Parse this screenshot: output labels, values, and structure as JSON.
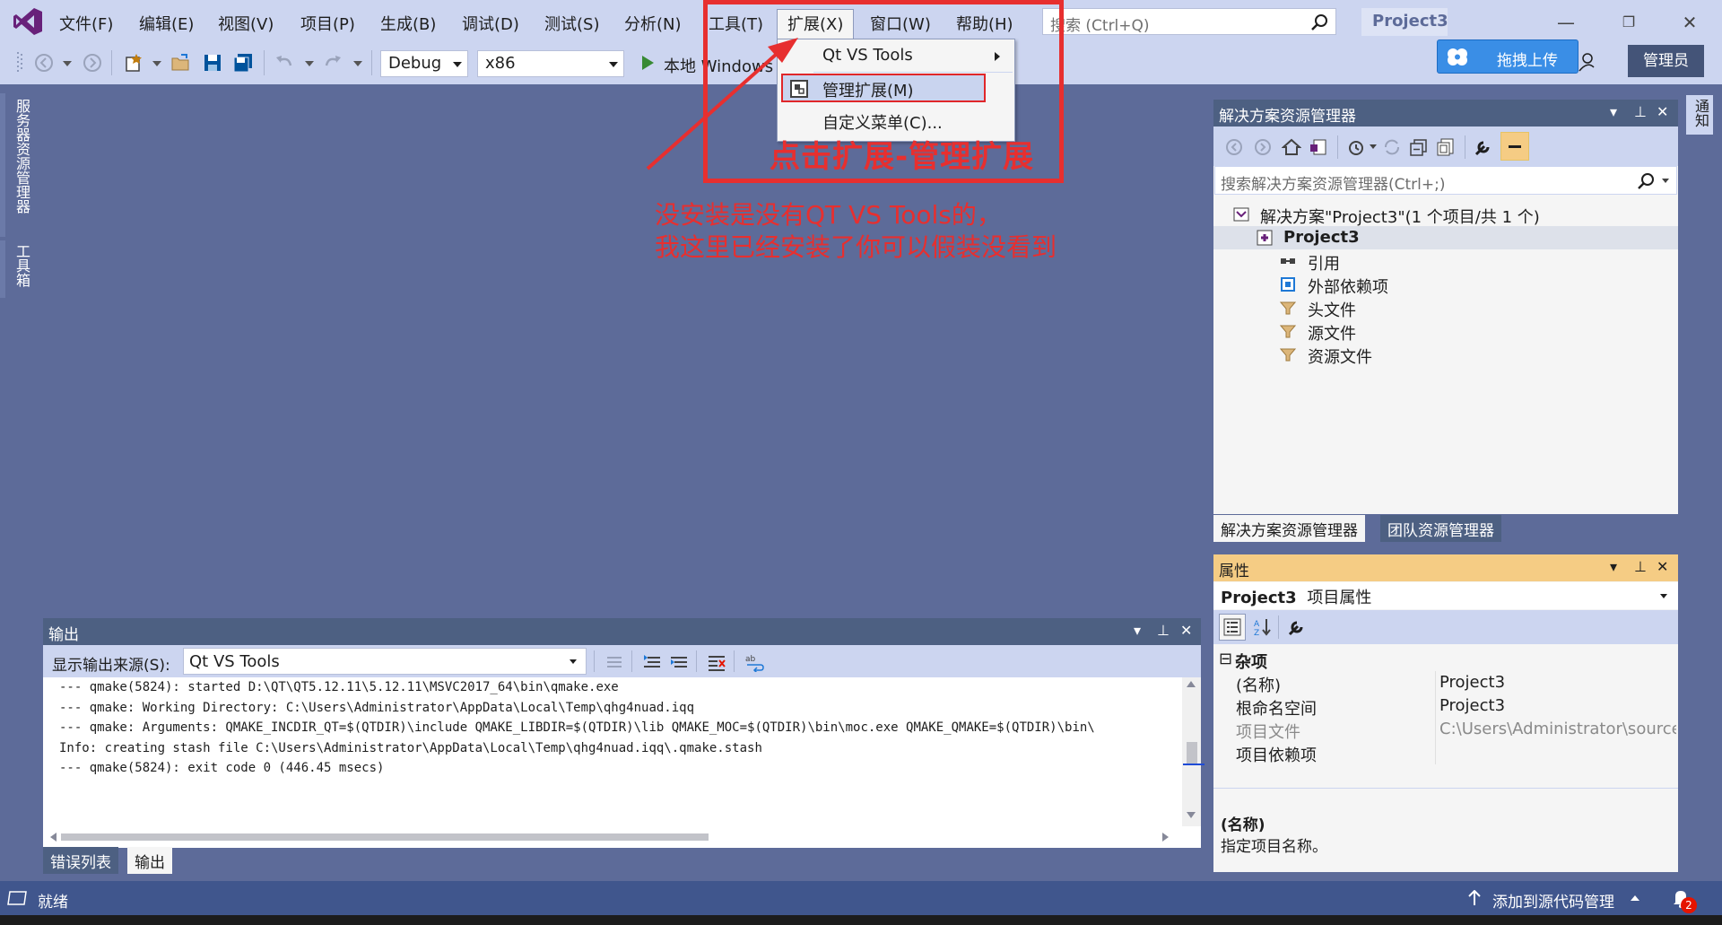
{
  "menubar": {
    "items": [
      "文件(F)",
      "编辑(E)",
      "视图(V)",
      "项目(P)",
      "生成(B)",
      "调试(D)",
      "测试(S)",
      "分析(N)",
      "工具(T)",
      "扩展(X)",
      "窗口(W)",
      "帮助(H)"
    ],
    "search_placeholder": "搜索 (Ctrl+Q)",
    "project_name": "Project3",
    "admin_label": "管理员",
    "upload_label": "拖拽上传"
  },
  "toolbar": {
    "config": "Debug",
    "platform": "x86",
    "run_label": "本地 Windows"
  },
  "side_tabs": [
    "服务器资源管理器",
    "工具箱"
  ],
  "right_tab": "通知",
  "extensions_menu": {
    "items": [
      "Qt VS Tools",
      "管理扩展(M)",
      "自定义菜单(C)..."
    ]
  },
  "annotations": {
    "box_label": "点击扩展-管理扩展",
    "note_line1": "没安装是没有QT VS Tools的，",
    "note_line2": "我这里已经安装了你可以假装没看到"
  },
  "solution_explorer": {
    "title": "解决方案资源管理器",
    "search_placeholder": "搜索解决方案资源管理器(Ctrl+;)",
    "tree": [
      {
        "label": "解决方案\"Project3\"(1 个项目/共 1 个)"
      },
      {
        "label": "Project3"
      },
      {
        "label": "引用"
      },
      {
        "label": "外部依赖项"
      },
      {
        "label": "头文件"
      },
      {
        "label": "源文件"
      },
      {
        "label": "资源文件"
      }
    ],
    "tabs": [
      "解决方案资源管理器",
      "团队资源管理器"
    ]
  },
  "properties": {
    "title": "属性",
    "object_name": "Project3",
    "object_type": "项目属性",
    "category": "杂项",
    "rows": [
      {
        "key": "(名称)",
        "value": "Project3"
      },
      {
        "key": "根命名空间",
        "value": "Project3"
      },
      {
        "key": "项目文件",
        "value": "C:\\Users\\Administrator\\source\\"
      },
      {
        "key": "项目依赖项",
        "value": ""
      }
    ],
    "desc_title": "(名称)",
    "desc_text": "指定项目名称。"
  },
  "output": {
    "title": "输出",
    "source_label": "显示输出来源(S):",
    "source_value": "Qt VS Tools",
    "lines": [
      "--- qmake(5824): started D:\\QT\\QT5.12.11\\5.12.11\\MSVC2017_64\\bin\\qmake.exe",
      "--- qmake: Working Directory: C:\\Users\\Administrator\\AppData\\Local\\Temp\\qhg4nuad.iqq",
      "--- qmake: Arguments:  QMAKE_INCDIR_QT=$(QTDIR)\\include QMAKE_LIBDIR=$(QTDIR)\\lib QMAKE_MOC=$(QTDIR)\\bin\\moc.exe QMAKE_QMAKE=$(QTDIR)\\bin\\",
      "Info: creating stash file C:\\Users\\Administrator\\AppData\\Local\\Temp\\qhg4nuad.iqq\\.qmake.stash",
      "--- qmake(5824): exit code 0 (446.45 msecs)"
    ],
    "tabs": [
      "错误列表",
      "输出"
    ]
  },
  "statusbar": {
    "left": "就绪",
    "right": "添加到源代码管理",
    "notification_count": "2"
  }
}
